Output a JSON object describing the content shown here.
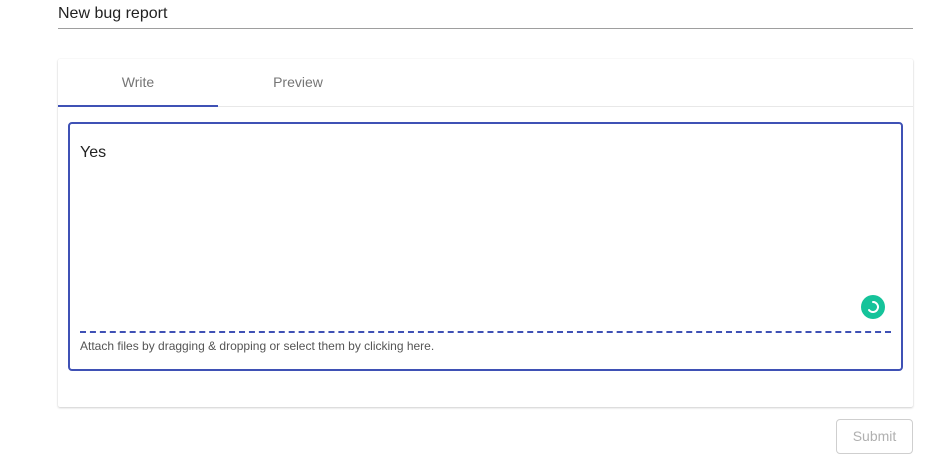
{
  "title_field": {
    "value": "New bug report"
  },
  "tabs": [
    {
      "label": "Write",
      "active": true
    },
    {
      "label": "Preview",
      "active": false
    }
  ],
  "editor": {
    "value": "Yes",
    "attach_hint": "Attach files by dragging & dropping or select them by clicking here."
  },
  "grammar_badge": {
    "icon": "grammarly-icon",
    "color": "#15c39a"
  },
  "submit": {
    "label": "Submit",
    "disabled": true
  },
  "colors": {
    "accent": "#3f51b5",
    "muted_text": "#757575",
    "disabled_text": "#b0b0b0"
  }
}
